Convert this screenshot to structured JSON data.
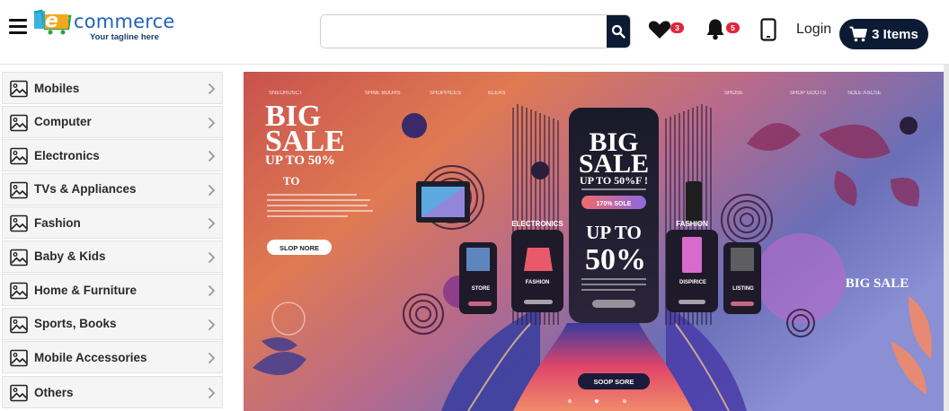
{
  "header": {
    "logo_letter": "e",
    "logo_text": "commerce",
    "tagline": "Your tagline here",
    "search": {
      "placeholder": "",
      "value": ""
    },
    "wishlist_count": "3",
    "notification_count": "5",
    "login_label": "Login",
    "cart_label": "3 Items"
  },
  "sidebar": {
    "items": [
      {
        "label": "Mobiles"
      },
      {
        "label": "Computer"
      },
      {
        "label": "Electronics"
      },
      {
        "label": "TVs & Appliances"
      },
      {
        "label": "Fashion"
      },
      {
        "label": "Baby & Kids"
      },
      {
        "label": "Home & Furniture"
      },
      {
        "label": "Sports, Books"
      },
      {
        "label": "Mobile Accessories"
      },
      {
        "label": "Others"
      }
    ]
  },
  "banner": {
    "left_big": "BIG",
    "left_sale": "SALE",
    "left_upto": "UP TO 50%",
    "left_to": "TO",
    "left_btn": "SLOP NORE",
    "center_big": "BIG",
    "center_sale": "SALE",
    "center_upto": "UP TO 50%F !",
    "center_pill": "170% SOLE",
    "center_upto2": "UP TO",
    "center_pct": "50%",
    "label_electronics": "ELECTRONICS",
    "label_fashion_r": "FASHION",
    "label_fashion_l": "FASHION",
    "label_store": "STORE",
    "label_dispirice": "DISPIRICE",
    "label_listing": "LISTING",
    "right_big_sale": "BIG SALE",
    "bottom_btn": "SOOP SORE",
    "top_nav": [
      "SNEORUSCT",
      "SHNE BOURS",
      "SHOPPICES",
      "ELEAS",
      "SHOSE",
      "SHOP GOOTS",
      "SOLE ASCSE"
    ]
  },
  "colors": {
    "navy": "#0c1b33",
    "badge_red": "#e0263a",
    "logo_blue": "#1f63b8",
    "sidebar_bg": "#f5f5f5"
  }
}
